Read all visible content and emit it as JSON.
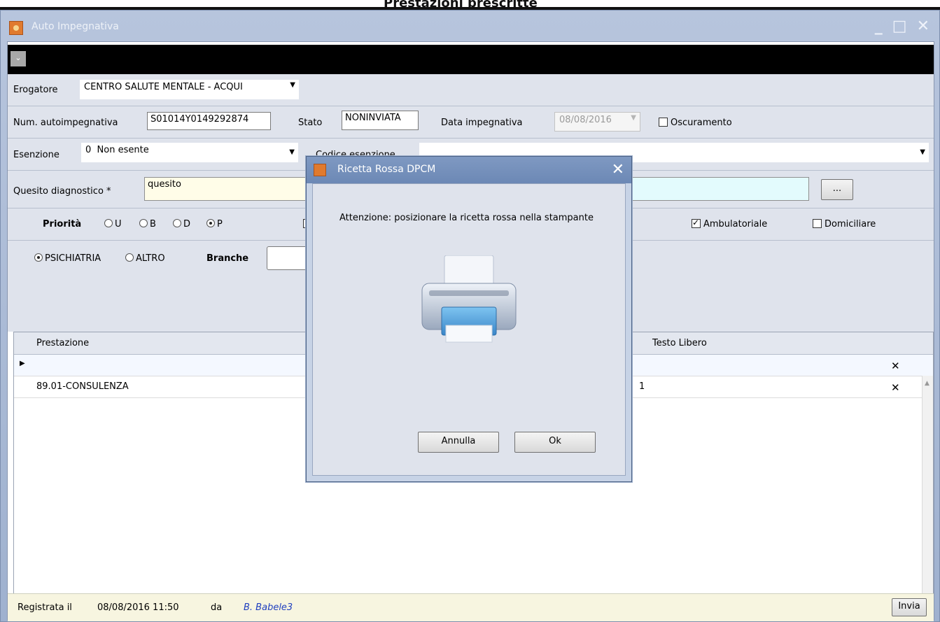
{
  "background": {
    "title": "Prestazioni prescritte"
  },
  "window": {
    "title": "Auto Impegnativa",
    "controls": {
      "minimize": "_",
      "maximize": "□",
      "close": "✕"
    }
  },
  "header_dropdown": {
    "glyph": "⌄"
  },
  "erogatore": {
    "label": "Erogatore",
    "value": "CENTRO SALUTE MENTALE - ACQUI"
  },
  "autoimpegnativa": {
    "num_label": "Num. autoimpegnativa",
    "num_value": "S01014Y0149292874",
    "stato_label": "Stato",
    "stato_value": "NONINVIATA",
    "data_label": "Data impegnativa",
    "data_value": "08/08/2016",
    "oscuramento_label": "Oscuramento",
    "oscuramento_checked": false
  },
  "esenzione": {
    "label": "Esenzione",
    "code": "0",
    "value": "Non esente",
    "codice_label": "Codice esenzione",
    "codice_value": ""
  },
  "quesito": {
    "label": "Quesito diagnostico *",
    "value": "quesito",
    "browse_label": "..."
  },
  "priorita": {
    "label": "Priorità",
    "options": [
      "U",
      "B",
      "D",
      "P"
    ],
    "selected": "P",
    "ambulatoriale_label": "Ambulatoriale",
    "ambulatoriale_checked": true,
    "domiciliare_label": "Domiciliare",
    "domiciliare_checked": false
  },
  "branche": {
    "psichiatria_label": "PSICHIATRIA",
    "altro_label": "ALTRO",
    "selected": "PSICHIATRIA",
    "label": "Branche",
    "value": ""
  },
  "grid": {
    "columns": [
      "Prestazione",
      "Testo Libero"
    ],
    "rows": [
      {
        "prestazione": "",
        "qty": "",
        "testo": "",
        "current": true
      },
      {
        "prestazione": "89.01-CONSULENZA",
        "qty": "1",
        "testo": "",
        "current": false
      }
    ]
  },
  "status": {
    "registrata_label": "Registrata il",
    "registrata_value": "08/08/2016 11:50",
    "da_label": "da",
    "user": "B. Babele3",
    "invia_label": "Invia"
  },
  "dialog": {
    "title": "Ricetta Rossa DPCM",
    "message": "Attenzione: posizionare la ricetta rossa nella stampante",
    "annulla_label": "Annulla",
    "ok_label": "Ok"
  },
  "colors": {
    "window_frame": "#a9bad6",
    "form_row": "#dfe3ec",
    "quesito_bg": "#fffde8",
    "quesito_cyan": "#e3fbfd",
    "status_bg": "#f7f5e0",
    "user_link": "#1f3fbf",
    "dialog_title": "#6c88b5"
  }
}
